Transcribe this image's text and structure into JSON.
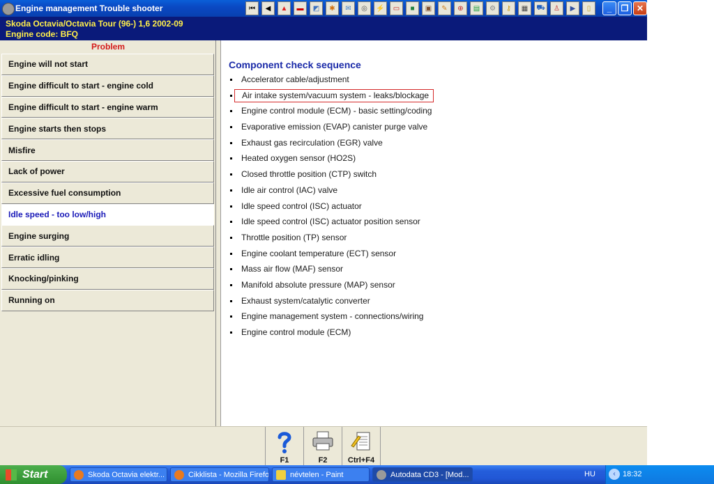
{
  "window": {
    "title": "Engine management Trouble shooter"
  },
  "vehicle": {
    "line1": "Skoda   Octavia/Octavia Tour (96-) 1,6   2002-09",
    "line2": "Engine code: BFQ"
  },
  "problems": {
    "header": "Problem",
    "items": [
      "Engine will not start",
      "Engine difficult to start - engine cold",
      "Engine difficult to start - engine warm",
      "Engine starts then stops",
      "Misfire",
      "Lack of power",
      "Excessive fuel consumption",
      "Idle speed - too low/high",
      "Engine surging",
      "Erratic idling",
      "Knocking/pinking",
      "Running on"
    ],
    "selected_index": 7
  },
  "components": {
    "title": "Component check sequence",
    "items": [
      "Accelerator cable/adjustment",
      "Air intake system/vacuum system - leaks/blockage",
      "Engine control module (ECM) - basic setting/coding",
      "Evaporative emission (EVAP) canister purge valve",
      "Exhaust gas recirculation (EGR) valve",
      "Heated oxygen sensor (HO2S)",
      "Closed throttle position (CTP) switch",
      "Idle air control (IAC) valve",
      "Idle speed control (ISC) actuator",
      "Idle speed control (ISC) actuator position sensor",
      "Throttle position (TP) sensor",
      "Engine coolant temperature (ECT) sensor",
      "Mass air flow (MAF) sensor",
      "Manifold absolute pressure (MAP) sensor",
      "Exhaust system/catalytic converter",
      "Engine management system - connections/wiring",
      "Engine control module (ECM)"
    ],
    "highlighted_index": 1
  },
  "function_keys": [
    {
      "label": "F1",
      "icon": "help-question-icon"
    },
    {
      "label": "F2",
      "icon": "printer-icon"
    },
    {
      "label": "Ctrl+F4",
      "icon": "notepad-pencil-icon"
    }
  ],
  "taskbar": {
    "start_label": "Start",
    "tasks": [
      "Skoda Octavia elektr...",
      "Cikklista - Mozilla Firefox",
      "névtelen - Paint",
      "Autodata CD3 - [Mod..."
    ],
    "language": "HU",
    "clock": "18:32"
  },
  "colors": {
    "titlebar": "#0a49c4",
    "vehicle_bg": "#0a1a7a",
    "vehicle_text": "#ffef4a",
    "problem_header": "#d41a1a",
    "selected_text": "#1a1ab8",
    "section_title": "#1a2aa8",
    "highlight_border": "#d42828"
  }
}
